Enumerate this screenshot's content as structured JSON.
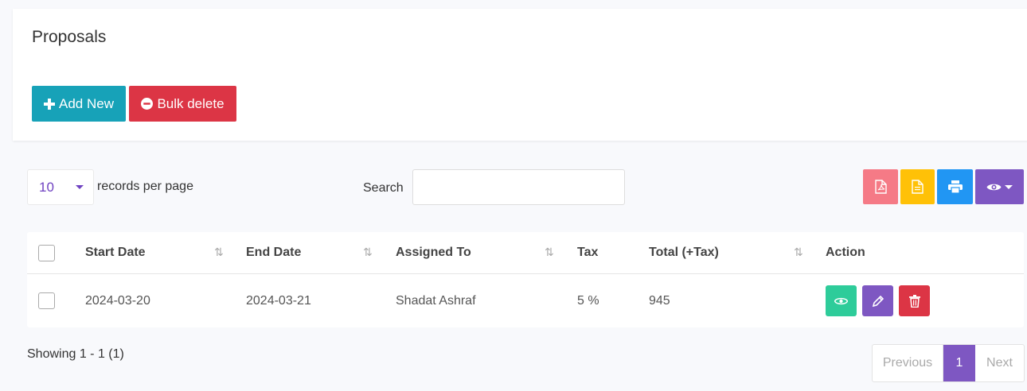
{
  "page": {
    "title": "Proposals"
  },
  "toolbar": {
    "add_new": "Add New",
    "bulk_delete": "Bulk delete"
  },
  "list_controls": {
    "per_page_value": "10",
    "per_page_label": "records per page",
    "search_label": "Search",
    "search_value": ""
  },
  "table": {
    "columns": [
      "Start Date",
      "End Date",
      "Assigned To",
      "Tax",
      "Total (+Tax)",
      "Action"
    ],
    "rows": [
      {
        "start_date": "2024-03-20",
        "end_date": "2024-03-21",
        "assigned_to": "Shadat Ashraf",
        "tax": "5 %",
        "total": "945"
      }
    ]
  },
  "footer": {
    "showing": "Showing 1 - 1 (1)",
    "prev": "Previous",
    "page": "1",
    "next": "Next"
  },
  "colors": {
    "primary": "#17a2b8",
    "danger": "#dc3545",
    "purple": "#7e57c2",
    "warning": "#ffc107",
    "info": "#2196f3",
    "success": "#2ecc9a",
    "pdf": "#f57a86"
  }
}
